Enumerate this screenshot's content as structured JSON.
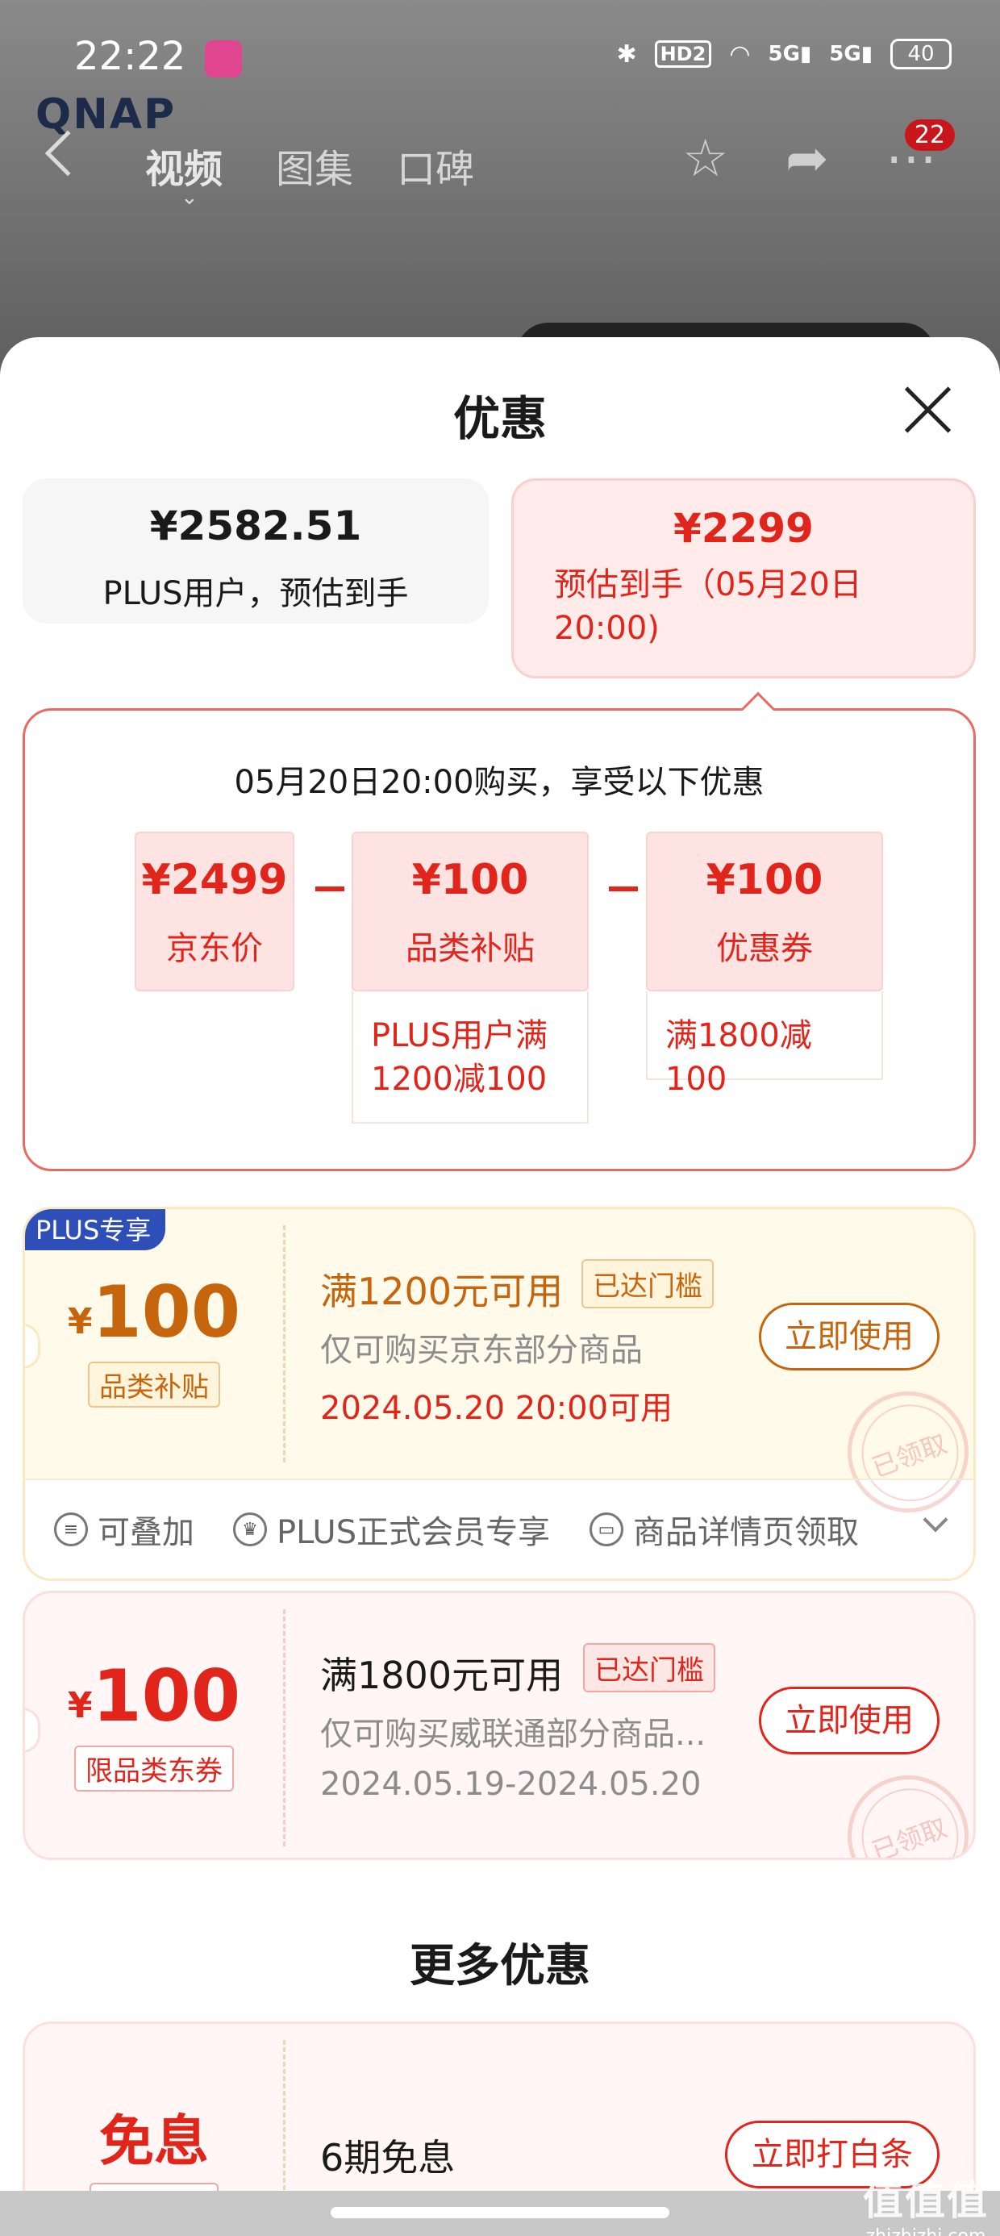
{
  "status_bar": {
    "time": "22:22",
    "hd_label": "HD2",
    "net1": "5G",
    "net2": "5G",
    "battery": "40"
  },
  "background": {
    "logo": "QNAP",
    "tabs": [
      "视频",
      "图集",
      "口碑"
    ],
    "badge_count": "22"
  },
  "sheet": {
    "title": "优惠",
    "plus_card": {
      "price": "¥2582.51",
      "label": "PLUS用户，预估到手"
    },
    "event_card": {
      "price": "¥2299",
      "label": "预估到手（05月20日20:00)"
    },
    "breakdown": {
      "heading": "05月20日20:00购买，享受以下优惠",
      "items": [
        {
          "value": "¥2499",
          "label": "京东价",
          "note": ""
        },
        {
          "value": "¥100",
          "label": "品类补贴",
          "note": "PLUS用户满1200减100"
        },
        {
          "value": "¥100",
          "label": "优惠券",
          "note": "满1800减100"
        }
      ]
    },
    "coupons": [
      {
        "tag": "PLUS专享",
        "symbol": "¥",
        "amount": "100",
        "type": "品类补贴",
        "title": "满1200元可用",
        "reached": "已达门槛",
        "desc": "仅可购买京东部分商品",
        "date": "2024.05.20 20:00可用",
        "button": "立即使用",
        "stamp": "已领取",
        "meta": [
          {
            "icon": "stack-icon",
            "label": "可叠加"
          },
          {
            "icon": "crown-icon",
            "label": "PLUS正式会员专享"
          },
          {
            "icon": "ticket-icon",
            "label": "商品详情页领取"
          }
        ]
      },
      {
        "symbol": "¥",
        "amount": "100",
        "type": "限品类东券",
        "title": "满1800元可用",
        "reached": "已达门槛",
        "desc": "仅可购买威联通部分商品...",
        "date": "2024.05.19-2024.05.20",
        "button": "立即使用",
        "stamp": "已领取"
      }
    ],
    "more_title": "更多优惠",
    "more_offer": {
      "label": "免息",
      "title": "6期免息",
      "button": "立即打白条"
    }
  },
  "watermark": {
    "logo": "值值值",
    "url": "zhizhizhi.com"
  },
  "colors": {
    "accent_red": "#e1251b",
    "accent_orange": "#c7650d",
    "plus_blue": "#2f4fb8"
  }
}
